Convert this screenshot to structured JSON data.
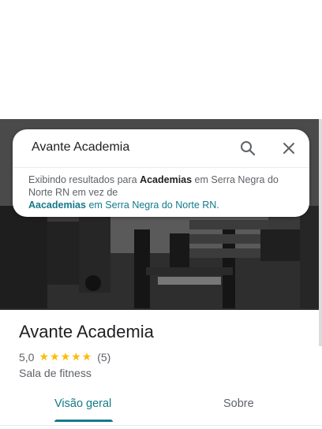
{
  "search": {
    "query": "Avante Academia",
    "notice_prefix": "Exibindo resultados para ",
    "notice_bold": "Academias",
    "notice_suffix": " em Serra Negra do Norte RN em vez de",
    "suggestion_bold": "Aacademias",
    "suggestion_suffix": " em Serra Negra do Norte RN."
  },
  "place": {
    "name": "Avante Academia",
    "rating": "5,0",
    "stars": "★★★★★",
    "review_count": "(5)",
    "category": "Sala de fitness"
  },
  "tabs": [
    {
      "label": "Visão geral",
      "active": true
    },
    {
      "label": "Sobre",
      "active": false
    }
  ],
  "colors": {
    "accent": "#137a8a",
    "star": "#fbbc04"
  },
  "icons": {
    "search": "search-icon",
    "close": "close-icon"
  }
}
